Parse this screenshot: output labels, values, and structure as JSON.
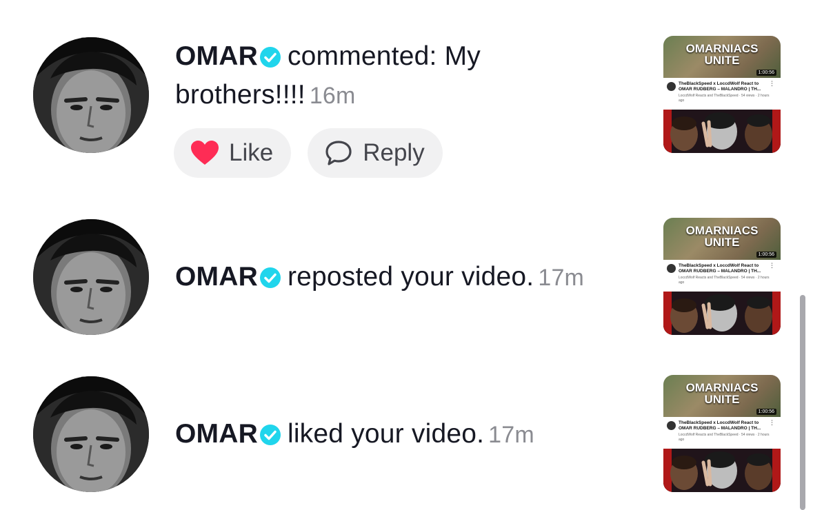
{
  "notifications": [
    {
      "username": "OMAR",
      "action": "commented: My brothers!!!!",
      "time": "16m",
      "like_label": "Like",
      "reply_label": "Reply",
      "thumbnail": {
        "title_line1": "OMARNIACS",
        "title_line2": "UNITE",
        "duration": "1:00:56",
        "video_title": "TheBlackSpeed x LoccdWolf React to OMAR RUDBERG – MALANDRO | TH...",
        "video_sub": "LoccdWolf Reacts and TheBlackSpeed · 54 views · 2 hours ago"
      }
    },
    {
      "username": "OMAR",
      "action": "reposted your video.",
      "time": "17m",
      "thumbnail": {
        "title_line1": "OMARNIACS",
        "title_line2": "UNITE",
        "duration": "1:00:56",
        "video_title": "TheBlackSpeed x LoccdWolf React to OMAR RUDBERG – MALANDRO | TH...",
        "video_sub": "LoccdWolf Reacts and TheBlackSpeed · 54 views · 2 hours ago"
      }
    },
    {
      "username": "OMAR",
      "action": "liked your video.",
      "time": "17m",
      "thumbnail": {
        "title_line1": "OMARNIACS",
        "title_line2": "UNITE",
        "duration": "1:00:56",
        "video_title": "TheBlackSpeed x LoccdWolf React to OMAR RUDBERG – MALANDRO | TH...",
        "video_sub": "LoccdWolf Reacts and TheBlackSpeed · 54 views · 2 hours ago"
      }
    }
  ],
  "icons": {
    "verified": "verified-badge-icon",
    "like": "heart-icon",
    "reply": "speech-bubble-icon"
  },
  "colors": {
    "verified": "#20d5ec",
    "like_heart": "#fe2c55",
    "pill_bg": "#f1f1f2",
    "time_text": "#8a8b91"
  }
}
